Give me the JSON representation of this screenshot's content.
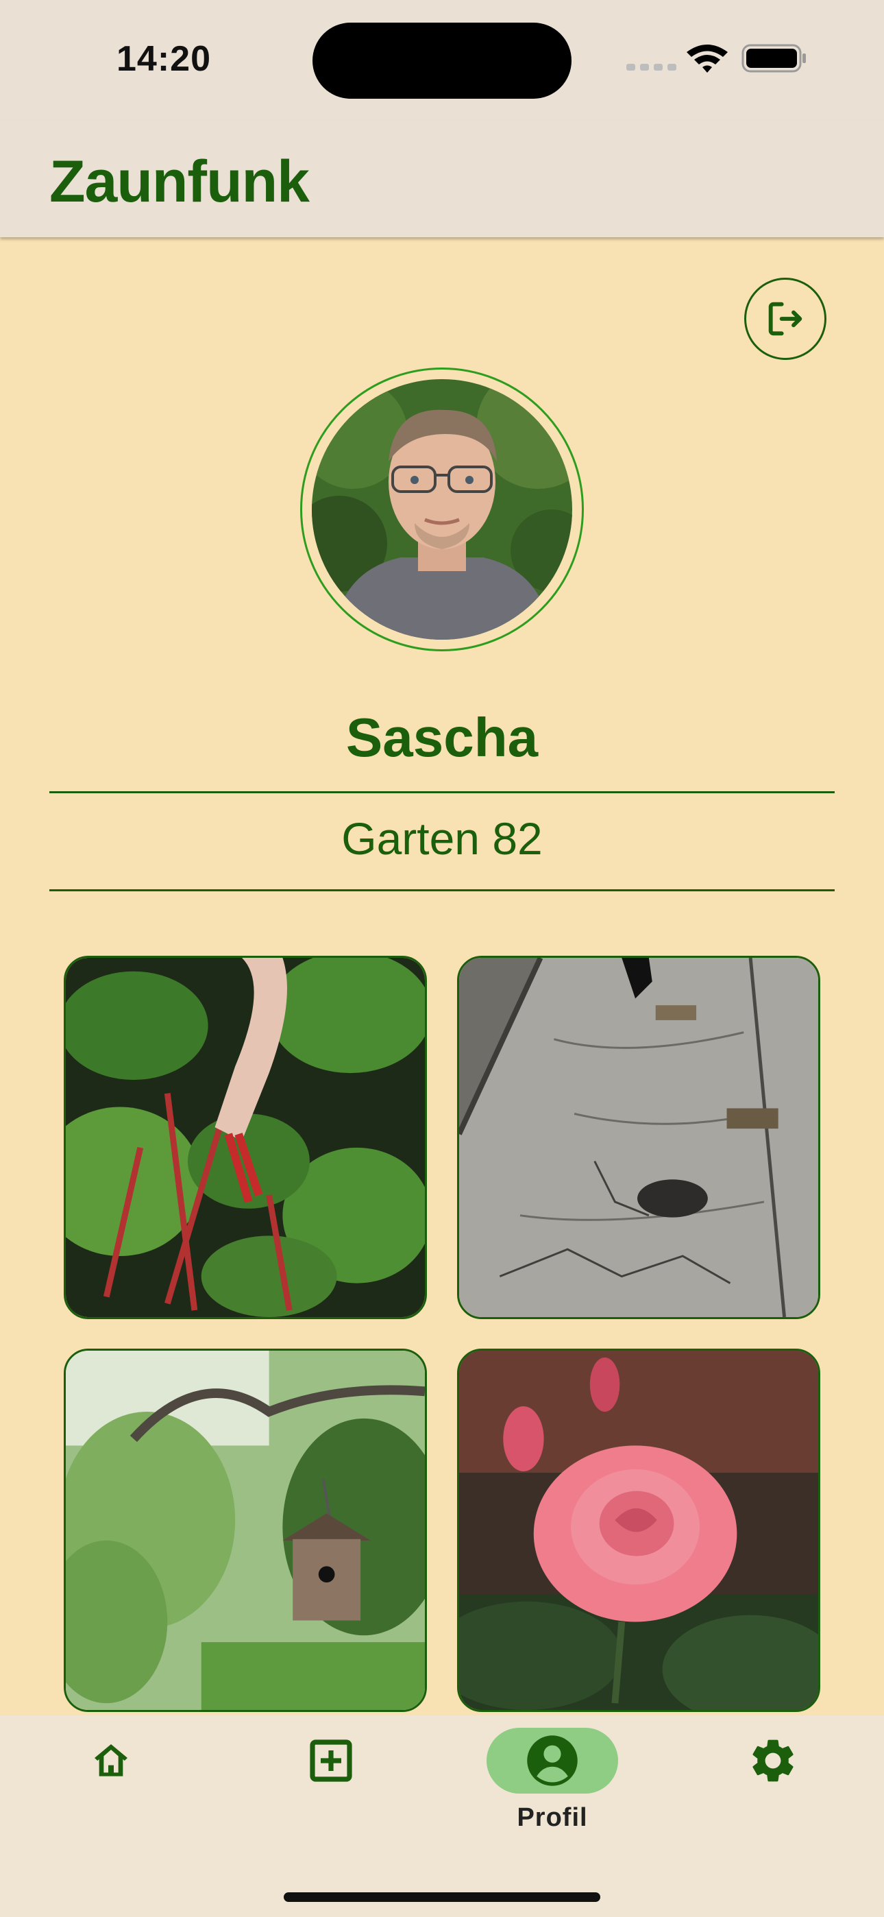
{
  "status_bar": {
    "time": "14:20",
    "icons": [
      "cellular-signal-icon",
      "wifi-icon",
      "battery-icon"
    ]
  },
  "app_bar": {
    "title": "Zaunfunk"
  },
  "profile": {
    "logout_icon": "logout-icon",
    "avatar_icon": "avatar-photo",
    "name": "Sascha",
    "garden": "Garten 82"
  },
  "photos": [
    {
      "subject": "rhubarb-harvest-photo"
    },
    {
      "subject": "cracked-pavement-photo"
    },
    {
      "subject": "birdhouse-in-tree-photo"
    },
    {
      "subject": "pink-rose-photo"
    }
  ],
  "bottom_nav": {
    "items": [
      {
        "icon": "home-icon",
        "label": "",
        "active": false
      },
      {
        "icon": "add-box-icon",
        "label": "",
        "active": false
      },
      {
        "icon": "account-circle-icon",
        "label": "Profil",
        "active": true
      },
      {
        "icon": "gear-icon",
        "label": "",
        "active": false
      }
    ]
  },
  "colors": {
    "primary": "#1b5e0c",
    "background": "#f8e2b3",
    "app_bar": "#ebe0d4",
    "nav_active_pill": "#8fcd84"
  }
}
